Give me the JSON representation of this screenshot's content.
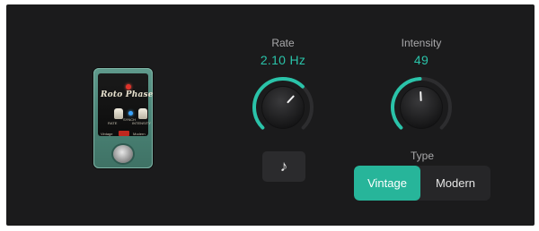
{
  "pedal": {
    "name": "Roto Phase",
    "knob_labels": [
      "RATE",
      "INTENSITY"
    ],
    "center_label": "SYNCH",
    "switch_labels": [
      "Vintage",
      "Modern"
    ]
  },
  "rate": {
    "label": "Rate",
    "value": "2.10 Hz",
    "knob_level": 0.66
  },
  "intensity": {
    "label": "Intensity",
    "value": "49",
    "knob_level": 0.49
  },
  "sync_button": {
    "icon": "music-note-icon",
    "glyph": "♪"
  },
  "type": {
    "label": "Type",
    "options": [
      "Vintage",
      "Modern"
    ],
    "selected": "Vintage"
  },
  "colors": {
    "accent": "#2ac3a9",
    "panel": "#1b1b1c",
    "track": "#2d2d2f"
  }
}
